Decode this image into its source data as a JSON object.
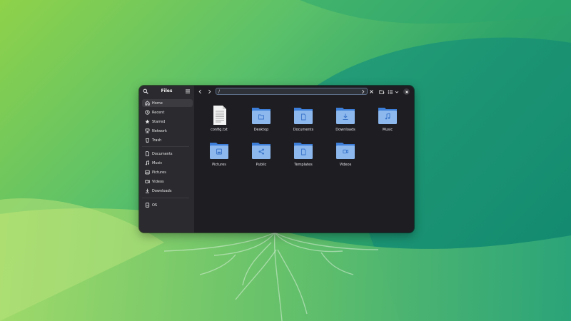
{
  "window": {
    "title": "Files"
  },
  "sidebar": {
    "groups": [
      [
        {
          "label": "Home",
          "icon": "home-icon",
          "active": true
        },
        {
          "label": "Recent",
          "icon": "clock-icon"
        },
        {
          "label": "Starred",
          "icon": "star-icon"
        },
        {
          "label": "Network",
          "icon": "network-icon"
        },
        {
          "label": "Trash",
          "icon": "trash-icon"
        }
      ],
      [
        {
          "label": "Documents",
          "icon": "document-icon"
        },
        {
          "label": "Music",
          "icon": "music-icon"
        },
        {
          "label": "Pictures",
          "icon": "picture-icon"
        },
        {
          "label": "Videos",
          "icon": "video-icon"
        },
        {
          "label": "Downloads",
          "icon": "download-icon"
        }
      ],
      [
        {
          "label": "OS",
          "icon": "drive-icon"
        }
      ]
    ]
  },
  "toolbar": {
    "path": "/"
  },
  "files": [
    {
      "name": "config.txt",
      "type": "file",
      "icon": "text-file-icon"
    },
    {
      "name": "Desktop",
      "type": "folder",
      "emblem": "folder-emblem-icon"
    },
    {
      "name": "Documents",
      "type": "folder",
      "emblem": "document-emblem-icon"
    },
    {
      "name": "Downloads",
      "type": "folder",
      "emblem": "download-emblem-icon"
    },
    {
      "name": "Music",
      "type": "folder",
      "emblem": "music-emblem-icon"
    },
    {
      "name": "Pictures",
      "type": "folder",
      "emblem": "picture-emblem-icon"
    },
    {
      "name": "Public",
      "type": "folder",
      "emblem": "share-emblem-icon"
    },
    {
      "name": "Templates",
      "type": "folder",
      "emblem": "template-emblem-icon"
    },
    {
      "name": "Videos",
      "type": "folder",
      "emblem": "video-emblem-icon"
    }
  ],
  "colors": {
    "folder_back": "#3d7ed8",
    "folder_front": "#8cb8ee",
    "emblem": "#3a74c8",
    "window_bg": "#1e1e22",
    "sidebar_bg": "#2b2b2f"
  }
}
